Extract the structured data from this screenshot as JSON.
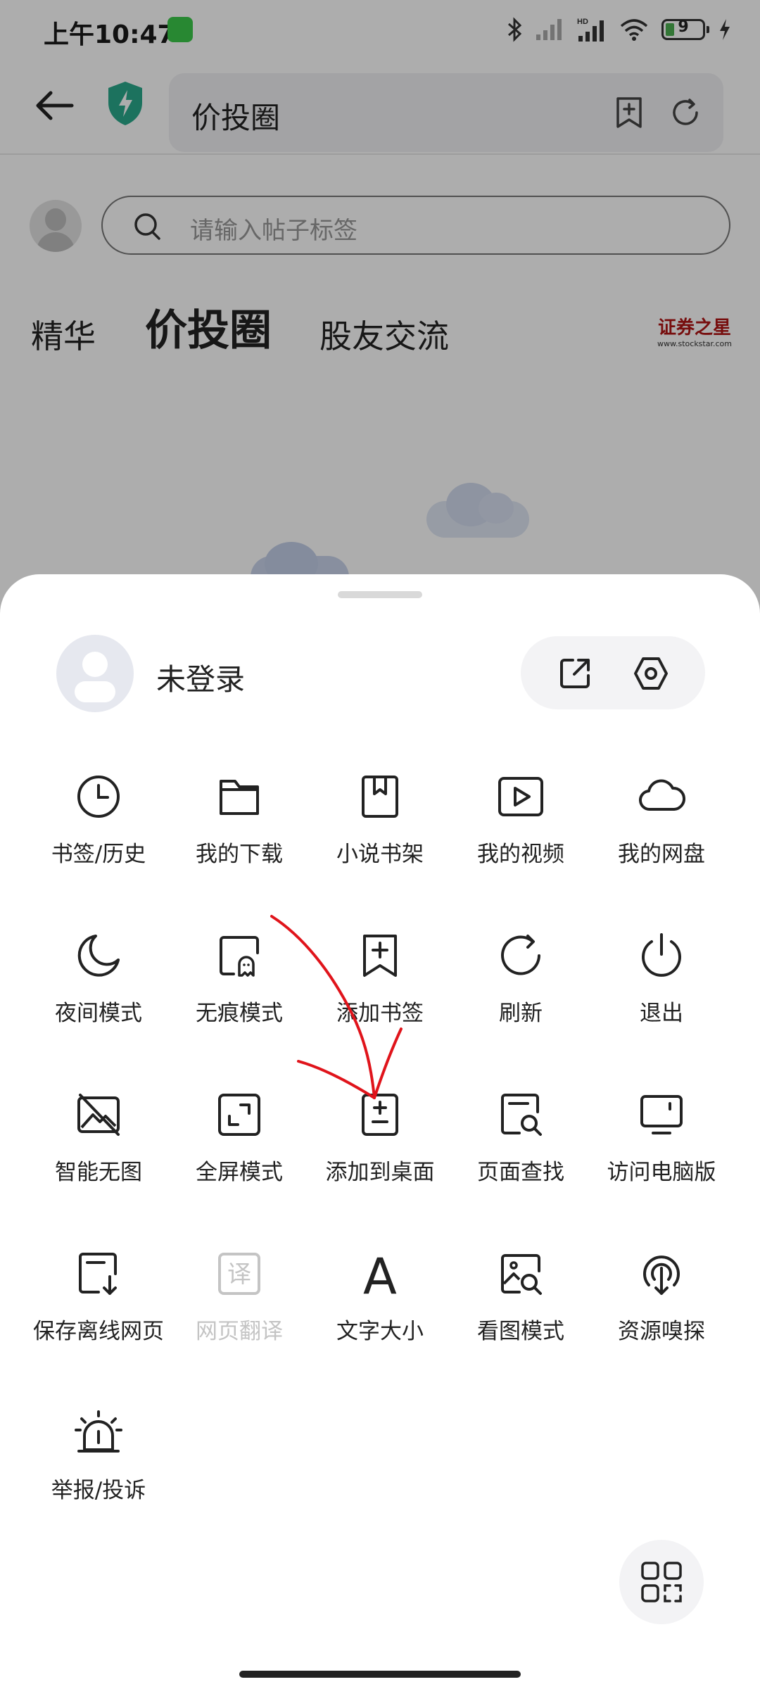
{
  "status_bar": {
    "time": "上午10:47",
    "battery_level": "9",
    "network_label": "HD"
  },
  "top_bar": {
    "url_text": "价投圈",
    "icons": [
      "back-arrow-icon",
      "shield-icon",
      "add-bookmark-icon",
      "refresh-icon"
    ]
  },
  "page": {
    "search_placeholder": "请输入帖子标签",
    "tabs": [
      "精华",
      "价投圈",
      "股友交流"
    ],
    "active_tab_index": 1,
    "logo_text": "证券之星",
    "logo_url_text": "www.stockstar.com"
  },
  "sheet": {
    "user_name": "未登录",
    "header_icons": [
      "share-icon",
      "settings-icon"
    ],
    "menu_items": [
      {
        "label": "书签/历史",
        "icon": "clock-icon",
        "enabled": true
      },
      {
        "label": "我的下载",
        "icon": "folder-icon",
        "enabled": true
      },
      {
        "label": "小说书架",
        "icon": "book-bookmark-icon",
        "enabled": true
      },
      {
        "label": "我的视频",
        "icon": "video-play-icon",
        "enabled": true
      },
      {
        "label": "我的网盘",
        "icon": "cloud-icon",
        "enabled": true
      },
      {
        "label": "夜间模式",
        "icon": "moon-icon",
        "enabled": true
      },
      {
        "label": "无痕模式",
        "icon": "ghost-file-icon",
        "enabled": true
      },
      {
        "label": "添加书签",
        "icon": "add-bookmark-icon",
        "enabled": true
      },
      {
        "label": "刷新",
        "icon": "refresh-icon",
        "enabled": true
      },
      {
        "label": "退出",
        "icon": "power-icon",
        "enabled": true
      },
      {
        "label": "智能无图",
        "icon": "no-image-icon",
        "enabled": true
      },
      {
        "label": "全屏模式",
        "icon": "fullscreen-icon",
        "enabled": true
      },
      {
        "label": "添加到桌面",
        "icon": "add-to-desktop-icon",
        "enabled": true
      },
      {
        "label": "页面查找",
        "icon": "page-search-icon",
        "enabled": true
      },
      {
        "label": "访问电脑版",
        "icon": "monitor-icon",
        "enabled": true
      },
      {
        "label": "保存离线网页",
        "icon": "save-offline-icon",
        "enabled": true
      },
      {
        "label": "网页翻译",
        "icon": "translate-icon",
        "enabled": false
      },
      {
        "label": "文字大小",
        "icon": "font-size-icon",
        "enabled": true
      },
      {
        "label": "看图模式",
        "icon": "image-view-icon",
        "enabled": true
      },
      {
        "label": "资源嗅探",
        "icon": "resource-sniff-icon",
        "enabled": true
      },
      {
        "label": "举报/投诉",
        "icon": "alarm-icon",
        "enabled": true
      }
    ],
    "translate_glyph": "译",
    "font_glyph": "A",
    "bottom_icon": "apps-grid-icon"
  },
  "colors": {
    "overlay": "rgba(0,0,0,0.32)",
    "shield": "#2aa98b",
    "annotation": "#e0141b",
    "disabled_text": "#c4c4c4"
  }
}
